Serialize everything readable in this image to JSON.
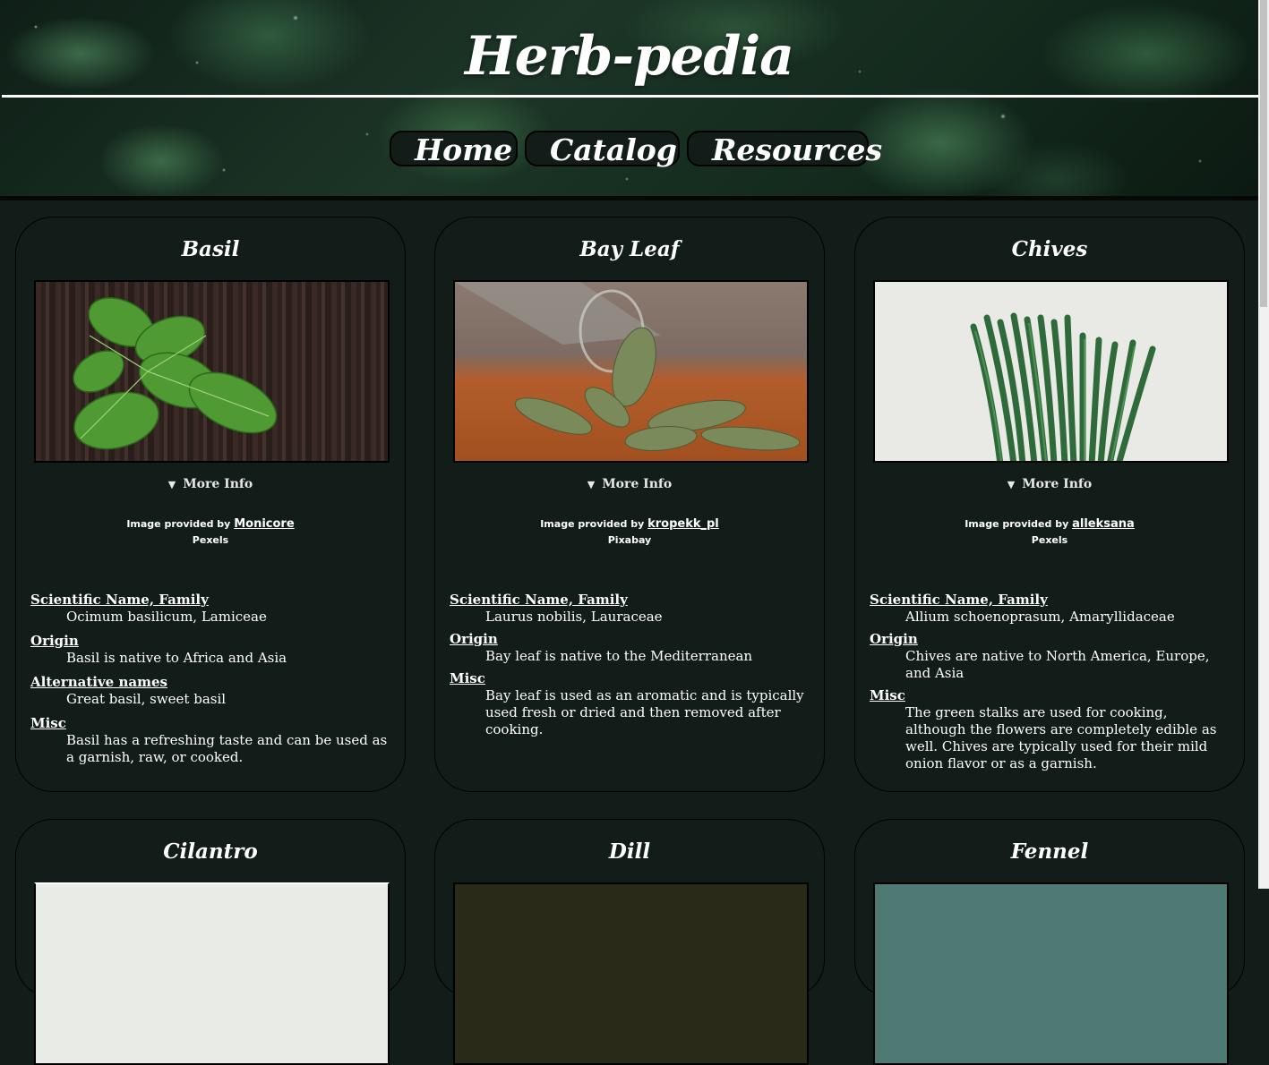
{
  "site": {
    "title": "Herb-pedia"
  },
  "nav": [
    {
      "label": "Home"
    },
    {
      "label": "Catalog"
    },
    {
      "label": "Resources"
    }
  ],
  "cards": [
    {
      "name": "Basil",
      "more_info": "More Info",
      "credit": {
        "prefix": "Image provided by",
        "author": "Monicore",
        "source": "Pexels"
      },
      "facts": [
        {
          "label": "Scientific Name, Family",
          "value": "Ocimum basilicum, Lamiceae"
        },
        {
          "label": "Origin",
          "value": "Basil is native to Africa and Asia"
        },
        {
          "label": "Alternative names",
          "value": "Great basil, sweet basil"
        },
        {
          "label": "Misc",
          "value": "Basil has a refreshing taste and can be used as a garnish, raw, or cooked."
        }
      ]
    },
    {
      "name": "Bay Leaf",
      "more_info": "More Info",
      "credit": {
        "prefix": "Image provided by",
        "author": "kropekk_pl",
        "source": "Pixabay"
      },
      "facts": [
        {
          "label": "Scientific Name, Family",
          "value": "Laurus nobilis, Lauraceae"
        },
        {
          "label": "Origin",
          "value": "Bay leaf is native to the Mediterranean"
        },
        {
          "label": "Misc",
          "value": "Bay leaf is used as an aromatic and is typically used fresh or dried and then removed after cooking."
        }
      ]
    },
    {
      "name": "Chives",
      "more_info": "More Info",
      "credit": {
        "prefix": "Image provided by",
        "author": "alleksana",
        "source": "Pexels"
      },
      "facts": [
        {
          "label": "Scientific Name, Family",
          "value": "Allium schoenoprasum, Amaryllidaceae"
        },
        {
          "label": "Origin",
          "value": "Chives are native to North America, Europe, and Asia"
        },
        {
          "label": "Misc",
          "value": "The green stalks are used for cooking, although the flowers are completely edible as well. Chives are typically used for their mild onion flavor or as a garnish."
        }
      ]
    },
    {
      "name": "Cilantro"
    },
    {
      "name": "Dill"
    },
    {
      "name": "Fennel"
    }
  ]
}
